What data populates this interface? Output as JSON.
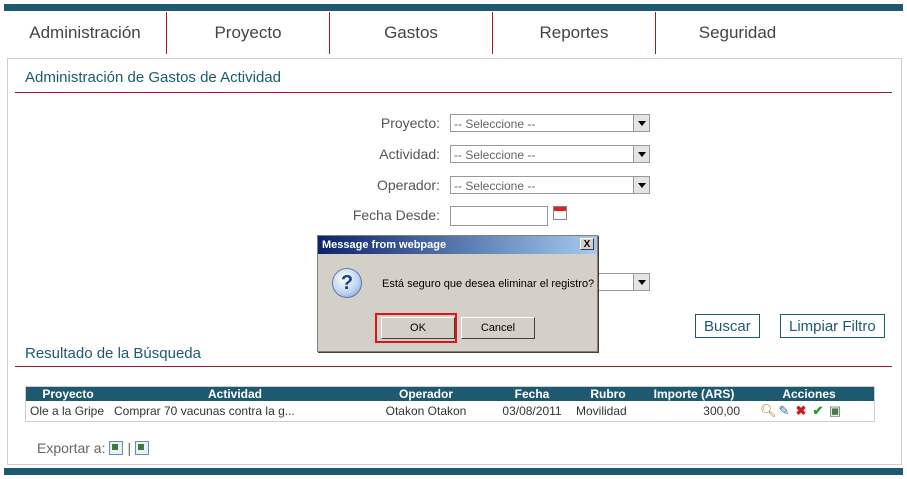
{
  "nav": [
    "Administración",
    "Proyecto",
    "Gastos",
    "Reportes",
    "Seguridad"
  ],
  "page": {
    "title": "Administración de Gastos de Actividad"
  },
  "filters": {
    "proyecto": {
      "label": "Proyecto:",
      "value": "-- Seleccione --"
    },
    "actividad": {
      "label": "Actividad:",
      "value": "-- Seleccione --"
    },
    "operador": {
      "label": "Operador:",
      "value": "-- Seleccione --"
    },
    "fecha_desde": {
      "label": "Fecha Desde:",
      "value": ""
    }
  },
  "buttons": {
    "buscar": "Buscar",
    "limpiar": "Limpiar Filtro"
  },
  "results": {
    "title": "Resultado de la Búsqueda",
    "columns": [
      "Proyecto",
      "Actividad",
      "Operador",
      "Fecha",
      "Rubro",
      "Importe (ARS)",
      "Acciones"
    ],
    "rows": [
      [
        "Ole a la Gripe",
        "Comprar 70 vacunas contra la g...",
        "Otakon Otakon",
        "03/08/2011",
        "Movilidad",
        "300,00"
      ]
    ]
  },
  "export": {
    "label": "Exportar a:",
    "separator": "|"
  },
  "dialog": {
    "title": "Message from webpage",
    "close": "X",
    "message": "Está seguro que desea eliminar el registro?",
    "ok": "OK",
    "cancel": "Cancel"
  },
  "colors": {
    "brand": "#1d5a72",
    "accent": "#a11a2a",
    "highlight": "#e0141e"
  },
  "icons": [
    "search-icon",
    "edit-icon",
    "delete-icon",
    "approve-icon",
    "comment-icon",
    "calendar-icon",
    "question-icon",
    "export-word-icon",
    "export-excel-icon"
  ]
}
